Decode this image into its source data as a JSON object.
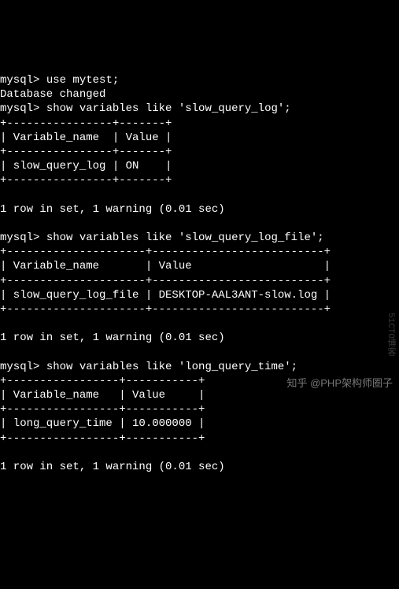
{
  "session": {
    "prompt": "mysql>",
    "cmd_use": "use mytest;",
    "use_result": "Database changed",
    "cmd_q1": "show variables like 'slow_query_log';",
    "cmd_q2": "show variables like 'slow_query_log_file';",
    "cmd_q3": "show variables like 'long_query_time';",
    "row_summary": "1 row in set, 1 warning (0.01 sec)"
  },
  "tables": {
    "t1": {
      "sep": "+----------------+-------+",
      "header": "| Variable_name  | Value |",
      "row": "| slow_query_log | ON    |"
    },
    "t2": {
      "sep": "+---------------------+--------------------------+",
      "header": "| Variable_name       | Value                    |",
      "row": "| slow_query_log_file | DESKTOP-AAL3ANT-slow.log |"
    },
    "t3": {
      "sep": "+-----------------+-----------+",
      "header": "| Variable_name   | Value     |",
      "row": "| long_query_time | 10.000000 |"
    }
  },
  "chart_data": {
    "type": "table",
    "tables": [
      {
        "query": "show variables like 'slow_query_log';",
        "columns": [
          "Variable_name",
          "Value"
        ],
        "rows": [
          [
            "slow_query_log",
            "ON"
          ]
        ]
      },
      {
        "query": "show variables like 'slow_query_log_file';",
        "columns": [
          "Variable_name",
          "Value"
        ],
        "rows": [
          [
            "slow_query_log_file",
            "DESKTOP-AAL3ANT-slow.log"
          ]
        ]
      },
      {
        "query": "show variables like 'long_query_time';",
        "columns": [
          "Variable_name",
          "Value"
        ],
        "rows": [
          [
            "long_query_time",
            "10.000000"
          ]
        ]
      }
    ]
  },
  "watermarks": {
    "side": "51CTO博客",
    "bottom": "知乎 @PHP架构师圈子"
  }
}
